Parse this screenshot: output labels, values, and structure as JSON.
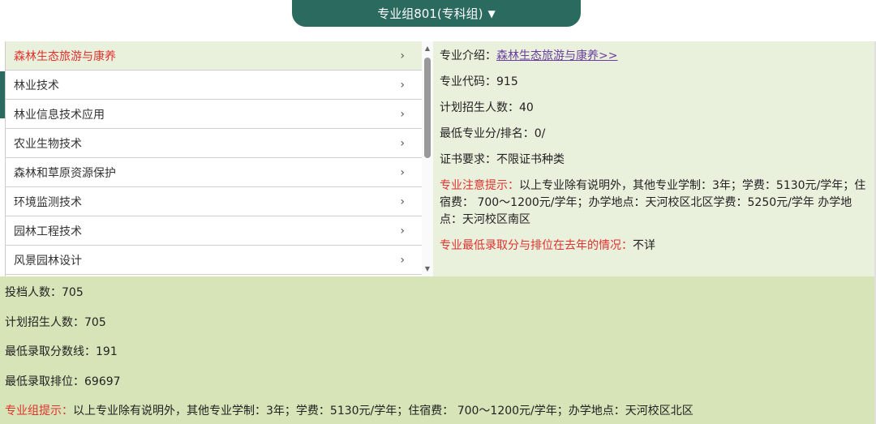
{
  "group_selector": {
    "label": "专业组801(专科组)"
  },
  "majors": [
    {
      "name": "森林生态旅游与康养",
      "active": true
    },
    {
      "name": "林业技术"
    },
    {
      "name": "林业信息技术应用"
    },
    {
      "name": "农业生物技术"
    },
    {
      "name": "森林和草原资源保护"
    },
    {
      "name": "环境监测技术"
    },
    {
      "name": "园林工程技术"
    },
    {
      "name": "风景园林设计"
    }
  ],
  "chevron": "›",
  "detail": {
    "intro_label": "专业介绍：",
    "intro_link": "森林生态旅游与康养>>",
    "code_label": "专业代码：",
    "code": "915",
    "plan_label": "计划招生人数：",
    "plan": "40",
    "min_label": "最低专业分/排名：",
    "min": "0/",
    "cert_label": "证书要求：",
    "cert": "不限证书种类",
    "notice_label": "专业注意提示：",
    "notice": "以上专业除有说明外，其他专业学制：3年；学费：5130元/学年；住宿费： 700～1200元/学年；办学地点：天河校区北区学费：5250元/学年 办学地点：天河校区南区",
    "last_year_label": "专业最低录取分与排位在去年的情况：",
    "last_year": "不详"
  },
  "summary": {
    "filed_label": "投档人数：",
    "filed": "705",
    "plan_label": "计划招生人数：",
    "plan": "705",
    "min_score_label": "最低录取分数线：",
    "min_score": "191",
    "min_rank_label": "最低录取排位：",
    "min_rank": "69697",
    "tip_label": "专业组提示：",
    "tip": "以上专业除有说明外，其他专业学制：3年；学费：5130元/学年；住宿费： 700～1200元/学年；办学地点：天河校区北区"
  }
}
